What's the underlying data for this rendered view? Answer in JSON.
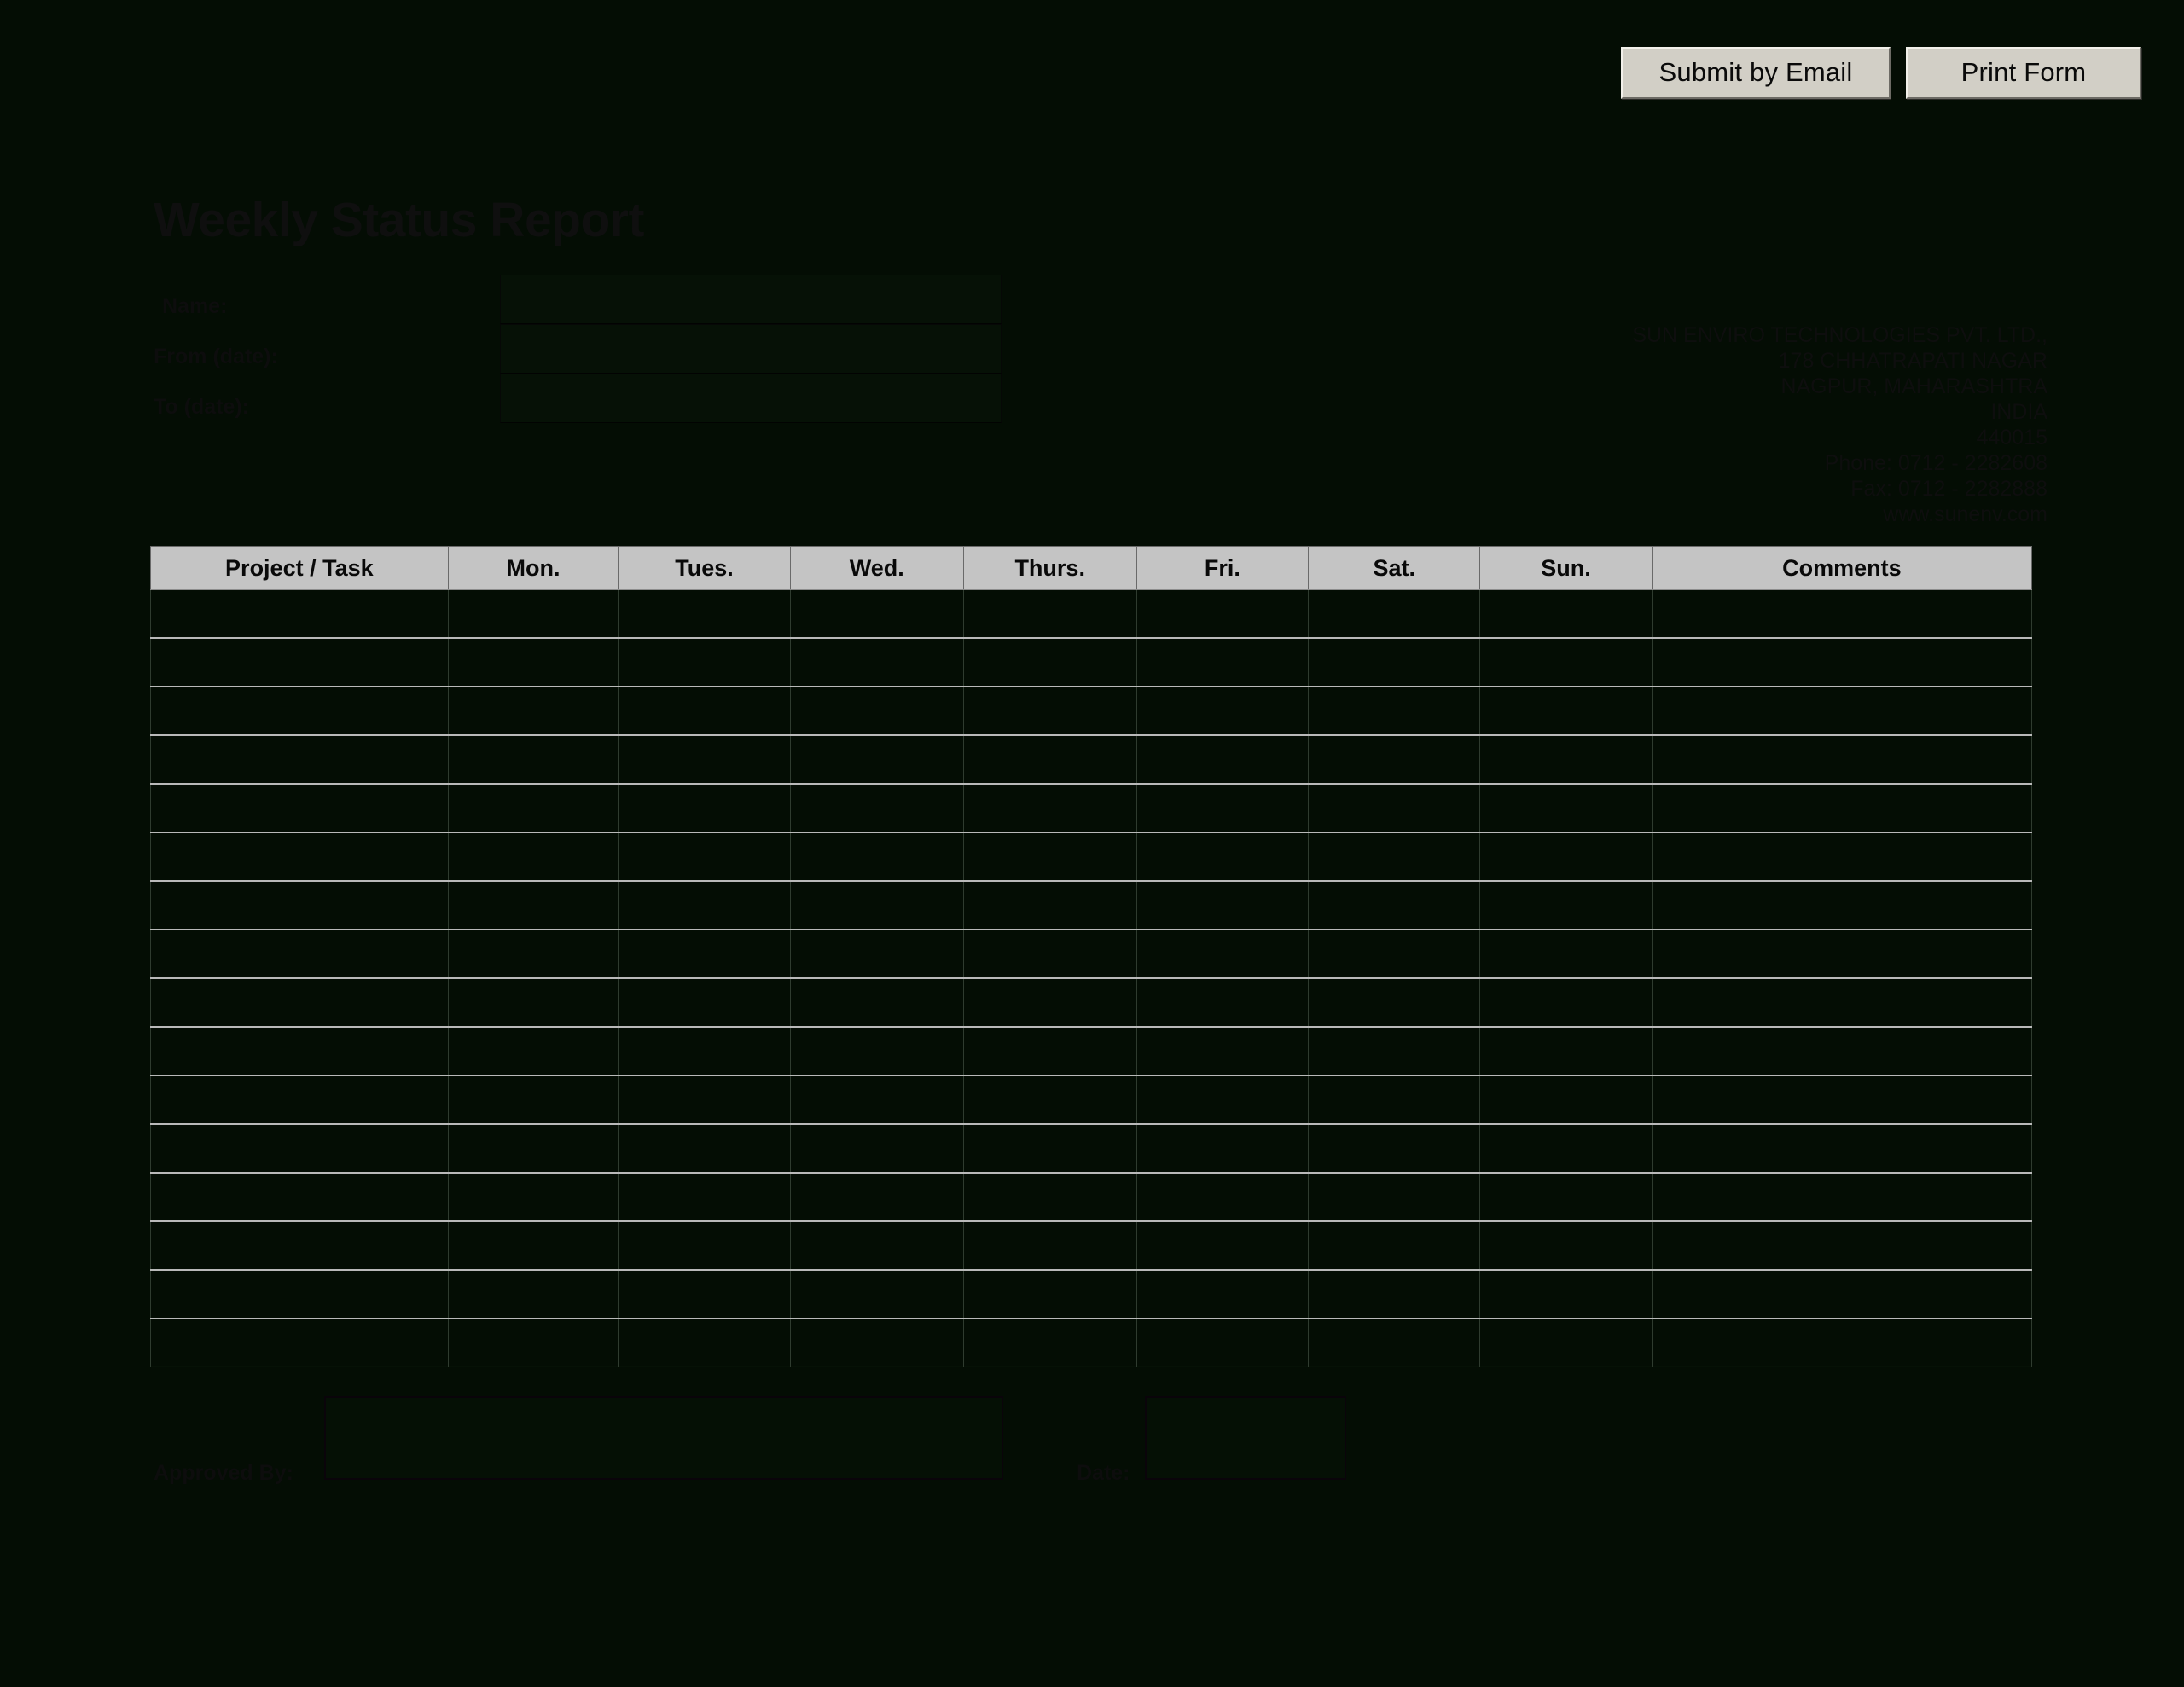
{
  "toolbar": {
    "submit_label": "Submit by Email",
    "print_label": "Print Form"
  },
  "document": {
    "title": "Weekly Status Report"
  },
  "identity": {
    "name_label": "Name:",
    "from_label": "From (date):",
    "to_label": "To (date):",
    "name_value": "",
    "from_value": "",
    "to_value": ""
  },
  "company": {
    "line1": "SUN ENVIRO TECHNOLOGIES PVT. LTD.,",
    "line2": "178 CHHATRAPATI NAGAR",
    "line3": "NAGPUR, MAHARASHTRA",
    "line4": "INDIA",
    "line5": "440015",
    "line6": "Phone: 0712 - 2282608",
    "line7": "Fax: 0712 - 2282888",
    "line8": "www.sunenv.com"
  },
  "table": {
    "headers": [
      "Project / Task",
      "Mon.",
      "Tues.",
      "Wed.",
      "Thurs.",
      "Fri.",
      "Sat.",
      "Sun.",
      "Comments"
    ],
    "row_count": 16,
    "rows": [
      [
        "",
        "",
        "",
        "",
        "",
        "",
        "",
        "",
        ""
      ],
      [
        "",
        "",
        "",
        "",
        "",
        "",
        "",
        "",
        ""
      ],
      [
        "",
        "",
        "",
        "",
        "",
        "",
        "",
        "",
        ""
      ],
      [
        "",
        "",
        "",
        "",
        "",
        "",
        "",
        "",
        ""
      ],
      [
        "",
        "",
        "",
        "",
        "",
        "",
        "",
        "",
        ""
      ],
      [
        "",
        "",
        "",
        "",
        "",
        "",
        "",
        "",
        ""
      ],
      [
        "",
        "",
        "",
        "",
        "",
        "",
        "",
        "",
        ""
      ],
      [
        "",
        "",
        "",
        "",
        "",
        "",
        "",
        "",
        ""
      ],
      [
        "",
        "",
        "",
        "",
        "",
        "",
        "",
        "",
        ""
      ],
      [
        "",
        "",
        "",
        "",
        "",
        "",
        "",
        "",
        ""
      ],
      [
        "",
        "",
        "",
        "",
        "",
        "",
        "",
        "",
        ""
      ],
      [
        "",
        "",
        "",
        "",
        "",
        "",
        "",
        "",
        ""
      ],
      [
        "",
        "",
        "",
        "",
        "",
        "",
        "",
        "",
        ""
      ],
      [
        "",
        "",
        "",
        "",
        "",
        "",
        "",
        "",
        ""
      ],
      [
        "",
        "",
        "",
        "",
        "",
        "",
        "",
        "",
        ""
      ],
      [
        "",
        "",
        "",
        "",
        "",
        "",
        "",
        "",
        ""
      ]
    ]
  },
  "approval": {
    "approved_by_label": "Approved By:",
    "approved_by_value": "",
    "date_label": "Date:",
    "date_value": ""
  },
  "colors": {
    "page_background": "#040d04",
    "header_fill": "#c4c4c4",
    "button_fill": "#d2cfc6",
    "row_rule": "#b9b9b9",
    "text": "#0d0d0d"
  }
}
